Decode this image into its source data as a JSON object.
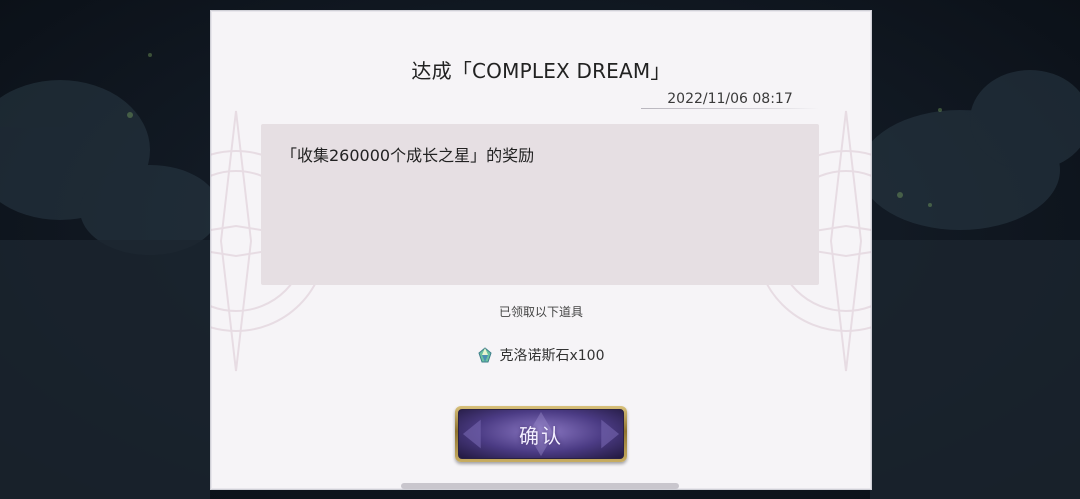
{
  "dialog": {
    "title": "达成「COMPLEX DREAM」",
    "date": "2022/11/06 08:17",
    "message": "「收集260000个成长之星」的奖励",
    "received_label": "已领取以下道具",
    "reward_item": {
      "icon": "chronos-stone-icon",
      "text": "克洛诺斯石x100"
    },
    "confirm_label": "确认"
  },
  "colors": {
    "dialog_bg": "#f6f4f7",
    "message_bg": "#e6dfe3",
    "button_purple": "#4b3b84",
    "button_gold": "#c8ad62"
  }
}
